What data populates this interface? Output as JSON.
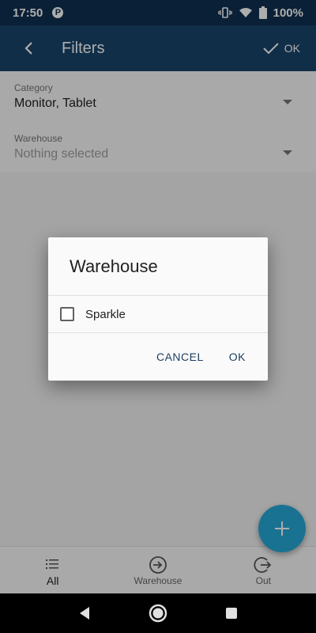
{
  "status_bar": {
    "time": "17:50",
    "app_badge": "P",
    "battery": "100%"
  },
  "app_bar": {
    "title": "Filters",
    "ok_label": "OK"
  },
  "filters": [
    {
      "label": "Category",
      "value": "Monitor, Tablet",
      "placeholder": false
    },
    {
      "label": "Warehouse",
      "value": "Nothing selected",
      "placeholder": true
    }
  ],
  "dialog": {
    "title": "Warehouse",
    "options": [
      {
        "label": "Sparkle",
        "checked": false
      }
    ],
    "cancel_label": "CANCEL",
    "ok_label": "OK"
  },
  "bottom_nav": {
    "items": [
      {
        "label": "All",
        "icon": "list-icon",
        "active": true
      },
      {
        "label": "Warehouse",
        "icon": "login-arrow-icon",
        "active": false
      },
      {
        "label": "Out",
        "icon": "logout-arrow-icon",
        "active": false
      }
    ]
  },
  "fab": {
    "icon": "plus-icon"
  },
  "colors": {
    "status_bar": "#0f3050",
    "app_bar": "#19456b",
    "fab": "#27a9d8",
    "dialog_button": "#1a3d5c"
  }
}
